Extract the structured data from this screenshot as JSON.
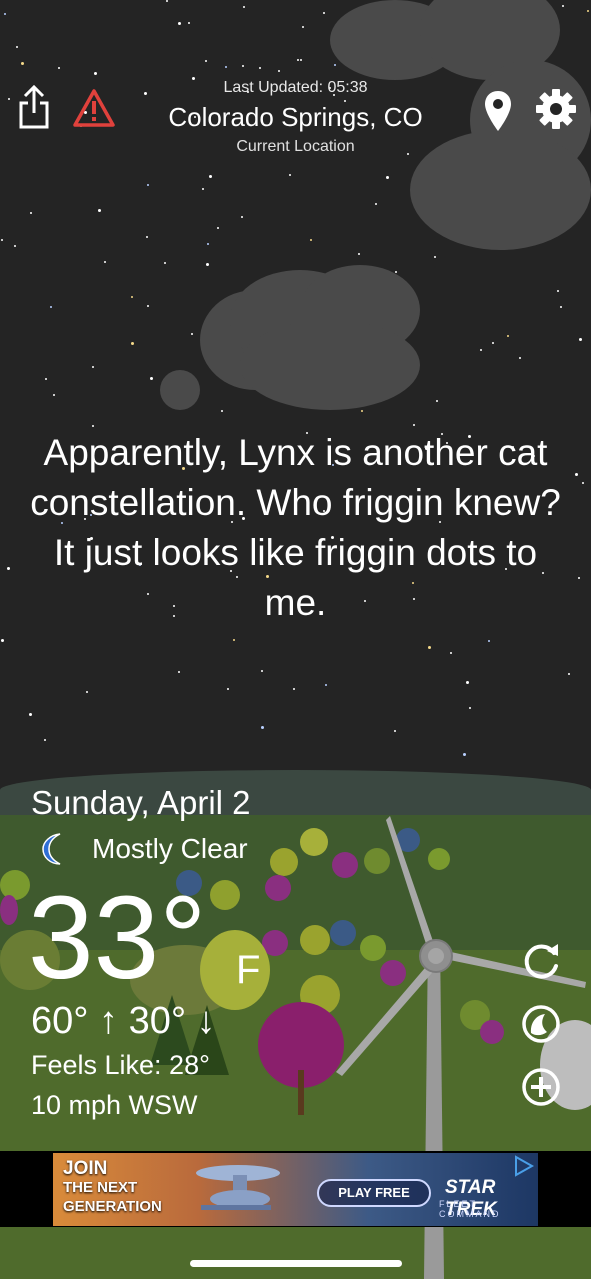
{
  "header": {
    "last_updated": "Last Updated: 05:38",
    "city": "Colorado Springs, CO",
    "current_location": "Current Location"
  },
  "icons": {
    "share": "share-icon",
    "alert": "warning-triangle-icon",
    "location": "location-pin-icon",
    "settings": "gear-icon",
    "moon": "crescent-moon-icon",
    "refresh": "refresh-icon",
    "radar": "radar-icon",
    "add": "plus-circle-icon"
  },
  "message": "Apparently, Lynx is another cat constellation. Who friggin knew? It just looks like friggin dots to me.",
  "weather": {
    "date": "Sunday, April 2",
    "condition": "Mostly Clear",
    "temperature": "33°",
    "unit": "F",
    "hi_lo": "60° ↑  30° ↓",
    "feels_like": "Feels Like: 28°",
    "wind": "10 mph WSW"
  },
  "ad": {
    "line1": "JOIN",
    "line2": "THE NEXT",
    "line3": "GENERATION",
    "cta": "PLAY FREE",
    "brand": "STAR TREK",
    "brand_sub": "FLEET COMMAND"
  },
  "colors": {
    "sky": "#242424",
    "alert": "#e0413c",
    "moon": "#2f6fd6"
  }
}
